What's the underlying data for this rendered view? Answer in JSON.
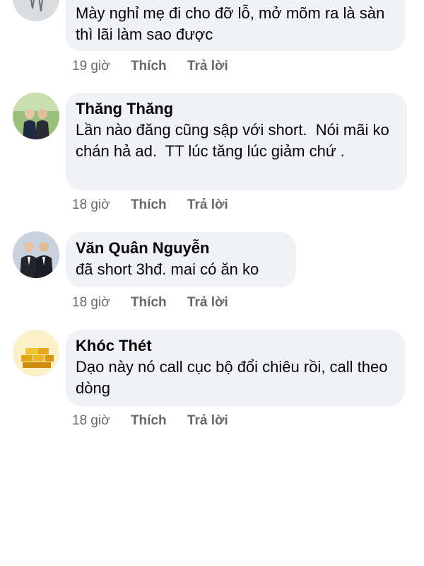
{
  "actions": {
    "like_label": "Thích",
    "reply_label": "Trả lời"
  },
  "comments": [
    {
      "author": "",
      "text": "Mày nghỉ mẹ đi cho đỡ lỗ, mở mõm ra là sàn thì lãi làm sao được",
      "time": "19 giờ",
      "avatar_icon": "photo-avatar-icon"
    },
    {
      "author": "Thăng Thăng",
      "text": "Lần nào đăng cũng sập với short.  Nói mãi ko chán hả ad.  TT lúc tăng lúc giảm chứ .",
      "time": "18 giờ",
      "avatar_icon": "couple-photo-avatar-icon"
    },
    {
      "author": "Văn Quân Nguyễn",
      "text": "đã short 3hđ. mai có ăn ko",
      "time": "18 giờ",
      "avatar_icon": "two-men-suits-avatar-icon"
    },
    {
      "author": "Khóc Thét",
      "text": "Dạo này nó call cục bộ đổi chiêu rồi, call theo dòng",
      "time": "18 giờ",
      "avatar_icon": "gold-bars-avatar-icon"
    }
  ]
}
